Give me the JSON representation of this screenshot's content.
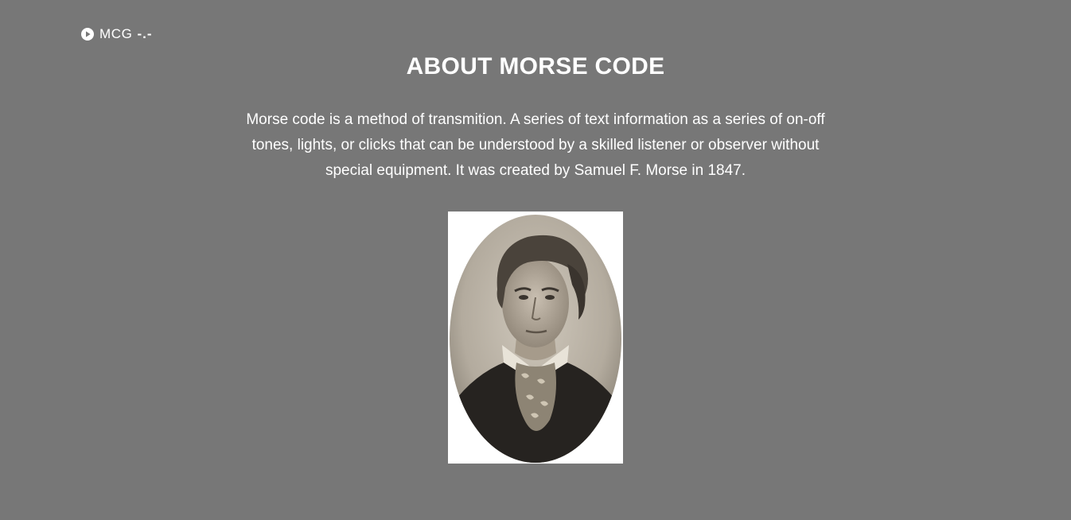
{
  "header": {
    "logo_text": "MCG",
    "logo_code": "-.-",
    "logo_icon": "play-circle-icon"
  },
  "main": {
    "title": "ABOUT MORSE CODE",
    "description": "Morse code is a method of transmition. A series of text information as a series of on-off tones, lights, or clicks that can be understood by a skilled listener or observer without special equipment. It was created by Samuel F. Morse in 1847.",
    "portrait": {
      "kind": "oval sepia portrait photograph"
    }
  },
  "colors": {
    "background": "#777777",
    "text": "#ffffff",
    "portrait_frame": "#ffffff",
    "portrait_tone": "#b8b0a4"
  }
}
